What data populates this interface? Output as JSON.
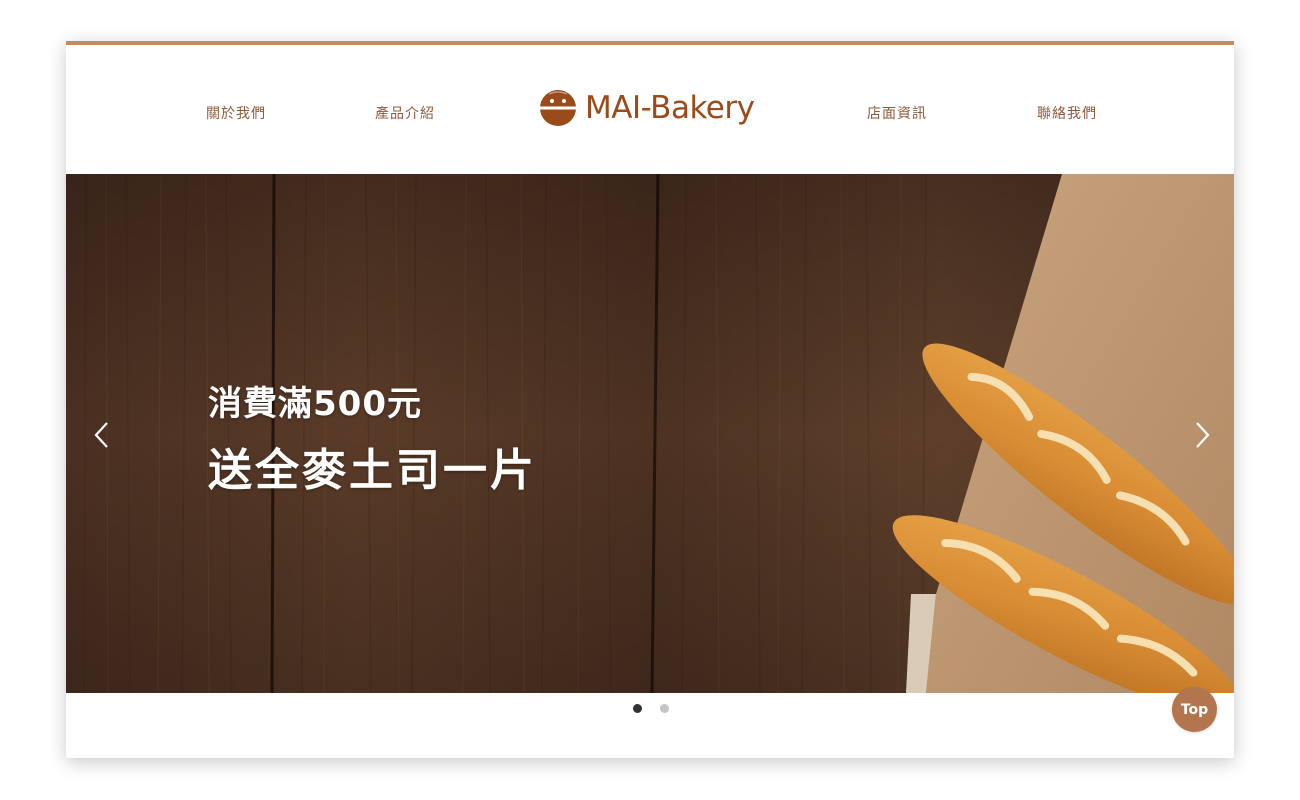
{
  "nav": {
    "about": "關於我們",
    "products": "產品介紹",
    "store": "店面資訊",
    "contact": "聯絡我們"
  },
  "logo": {
    "text": "MAI-Bakery",
    "icon": "bread-face-icon"
  },
  "hero": {
    "line1": "消費滿500元",
    "line2": "送全麥土司一片",
    "image": "baguettes on wooden table",
    "prev_icon": "chevron-left-icon",
    "next_icon": "chevron-right-icon"
  },
  "carousel": {
    "slide_count": 2,
    "active_slide": 1
  },
  "top_button": {
    "label": "Top"
  },
  "colors": {
    "accent": "#c98a5c",
    "nav_text": "#8c5a3a",
    "logo": "#9b4a1a",
    "top_button": "#b2754d",
    "dot_active": "#333333",
    "dot_inactive": "#c4c4c4"
  }
}
